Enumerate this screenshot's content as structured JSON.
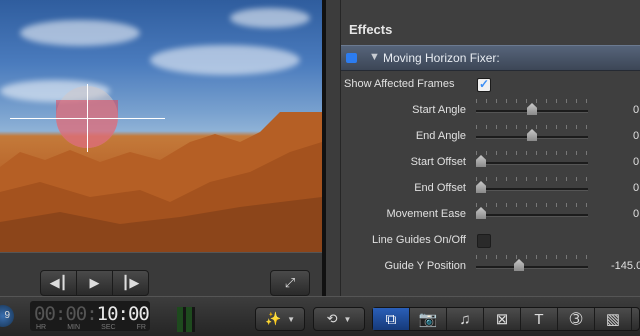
{
  "transport": {
    "prev_icon": "previous-icon",
    "play_icon": "play-icon",
    "next_icon": "next-icon",
    "fullscreen_icon": "fullscreen-icon"
  },
  "inspector": {
    "section_title": "Effects",
    "effect_name": "Moving Horizon Fixer:",
    "show_affected_frames": {
      "label": "Show Affected Frames",
      "checked": true
    },
    "params": [
      {
        "label": "Start Angle",
        "value": "0",
        "level": 0.5
      },
      {
        "label": "End Angle",
        "value": "0",
        "level": 0.5
      },
      {
        "label": "Start Offset",
        "value": "0",
        "level": 0.0
      },
      {
        "label": "End Offset",
        "value": "0",
        "level": 0.0
      },
      {
        "label": "Movement Ease",
        "value": "0",
        "level": 0.0
      }
    ],
    "line_guides": {
      "label": "Line Guides On/Off",
      "checked": false
    },
    "guide_y": {
      "label": "Guide Y Position",
      "value": "-145.0",
      "level": 0.37
    }
  },
  "toolbar": {
    "badge": "9",
    "timecode": {
      "dim": "00:00:",
      "bright": "10:00"
    },
    "timecode_units": [
      "HR",
      "MIN",
      "SEC",
      "FR"
    ],
    "enhance_icon": "magic-wand-icon",
    "retime_icon": "retime-icon",
    "tools": [
      "inspector-icon",
      "camera-icon",
      "music-icon",
      "transitions-icon",
      "title-icon",
      "generators-icon",
      "themes-icon"
    ],
    "title_glyph": "T"
  }
}
